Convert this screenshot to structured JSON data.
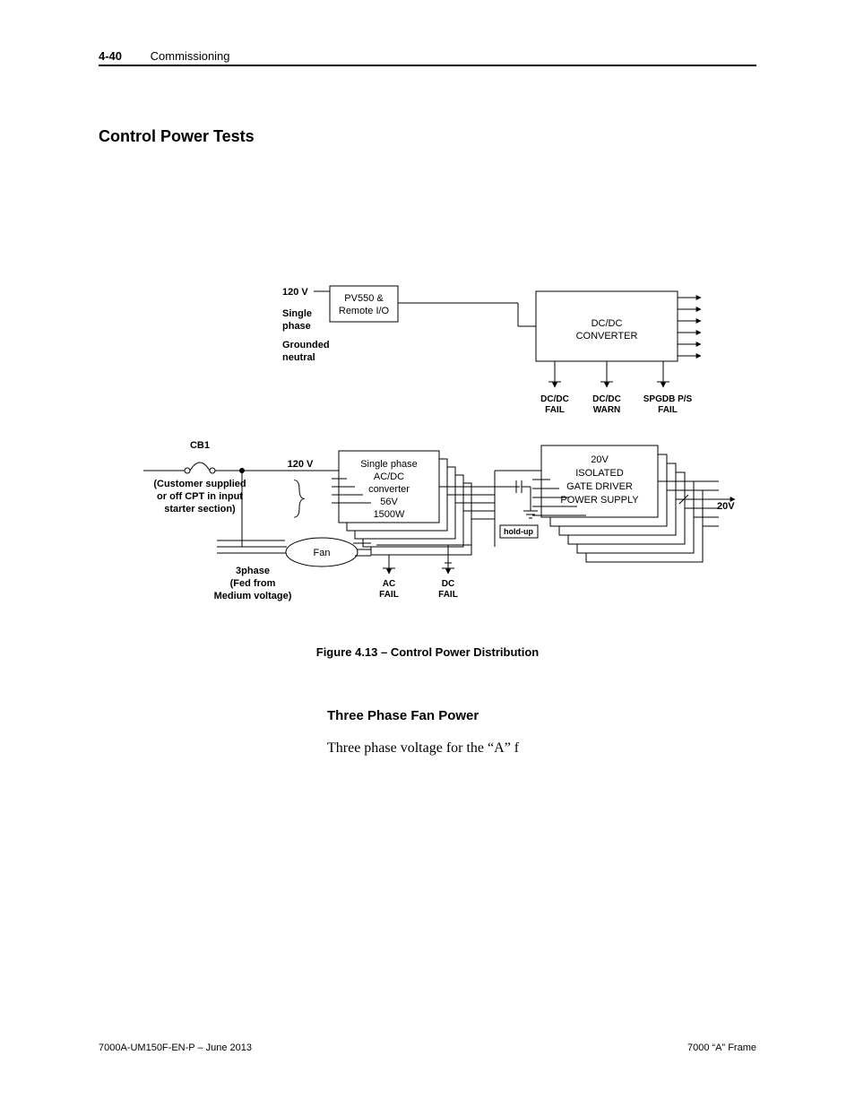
{
  "header": {
    "page_number": "4-40",
    "section": "Commissioning"
  },
  "title": "Control Power Tests",
  "caption": "Figure 4.13 – Control Power Distribution",
  "subheading": "Three Phase Fan Power",
  "body": "Three phase voltage for the “A” f",
  "footer": {
    "left": "7000A-UM150F-EN-P – June 2013",
    "right": "7000 “A” Frame"
  },
  "diagram": {
    "input1": {
      "voltage": "120 V",
      "l1": "Single",
      "l2": "phase",
      "l3": "Grounded",
      "l4": "neutral"
    },
    "pv550": {
      "l1": "PV550 &",
      "l2": "Remote I/O"
    },
    "dcdc": {
      "l1": "DC/DC",
      "l2": "CONVERTER"
    },
    "dcfail": {
      "l1": "DC/DC",
      "l2": "FAIL"
    },
    "dcwarn": {
      "l1": "DC/DC",
      "l2": "WARN"
    },
    "spgdb": {
      "l1": "SPGDB P/S",
      "l2": "FAIL"
    },
    "cb1": "CB1",
    "cb1note": {
      "l1": "(Customer supplied",
      "l2": "or off CPT in input",
      "l3": "starter section)"
    },
    "mid120": "120 V",
    "acdc": {
      "l1": "Single phase",
      "l2": "AC/DC",
      "l3": "converter",
      "l4": "56V",
      "l5": "1500W"
    },
    "holdup": "hold-up",
    "gate": {
      "l1": "20V",
      "l2": "ISOLATED",
      "l3": "GATE DRIVER",
      "l4": "POWER SUPPLY"
    },
    "out20v": "20V",
    "acfail": {
      "l1": "AC",
      "l2": "FAIL"
    },
    "dcfail2": {
      "l1": "DC",
      "l2": "FAIL"
    },
    "fan": "Fan",
    "threephase": {
      "l1": "3phase",
      "l2": "(Fed from",
      "l3": "Medium voltage)"
    }
  }
}
